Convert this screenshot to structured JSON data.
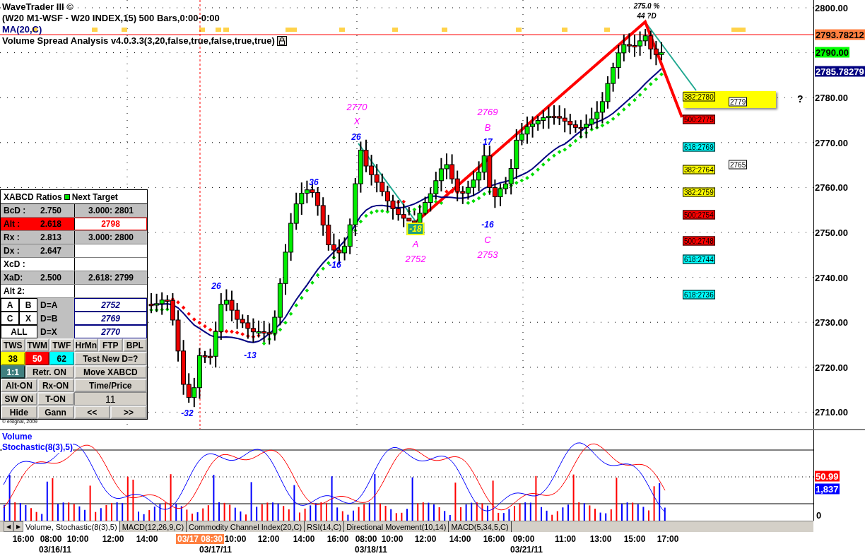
{
  "header": {
    "title": "WaveTrader III ©",
    "symbol_line": "(W20 M1-WSF - W20 INDEX,15) 500 Bars,0:00-0:00",
    "ma_label": "MA(20,C)",
    "study_label": "Volume Spread Analysis v4.0.3.3(3,20,false,true,false,true,true)"
  },
  "top_annotations": [
    "275.0 %",
    "44 ?D"
  ],
  "chart_labels": [
    {
      "text": "2770",
      "kind": "point"
    },
    {
      "text": "X",
      "kind": "point"
    },
    {
      "text": "26",
      "kind": "count"
    },
    {
      "text": "2769",
      "kind": "point"
    },
    {
      "text": "B",
      "kind": "point"
    },
    {
      "text": "17",
      "kind": "count"
    },
    {
      "text": "36",
      "kind": "count"
    },
    {
      "text": "-18",
      "kind": "highlight"
    },
    {
      "text": "-16",
      "kind": "count"
    },
    {
      "text": "A",
      "kind": "point"
    },
    {
      "text": "C",
      "kind": "point"
    },
    {
      "text": "2752",
      "kind": "point"
    },
    {
      "text": "2753",
      "kind": "point"
    },
    {
      "text": "-16",
      "kind": "count"
    },
    {
      "text": "26",
      "kind": "count"
    },
    {
      "text": "-13",
      "kind": "count"
    },
    {
      "text": "-32",
      "kind": "count"
    }
  ],
  "fib_levels": [
    {
      "text": "382:2780",
      "color": "#ffff00"
    },
    {
      "text": "500:2775",
      "color": "#ff0000"
    },
    {
      "text": "618:2769",
      "color": "#00ffff"
    },
    {
      "text": "382:2764",
      "color": "#ffff00"
    },
    {
      "text": "382:2759",
      "color": "#ffff00"
    },
    {
      "text": "500:2754",
      "color": "#ff0000"
    },
    {
      "text": "500:2748",
      "color": "#ff0000"
    },
    {
      "text": "618:2744",
      "color": "#00ffff"
    },
    {
      "text": "618:2736",
      "color": "#00ffff"
    }
  ],
  "projections": [
    "2779",
    "2765"
  ],
  "question_mark": "?",
  "xabcd_panel": {
    "title": "XABCD Ratios",
    "legend": "Next Target",
    "ratios": [
      {
        "label": "BcD :",
        "value": "2.750",
        "target": "3.000: 2801",
        "kind": "filled"
      },
      {
        "label": "Alt  :",
        "value": "2.618",
        "target": "2798",
        "kind": "alert"
      },
      {
        "label": "Rx  :",
        "value": "2.813",
        "target": "3.000: 2800",
        "kind": "filled"
      },
      {
        "label": "Dx  :",
        "value": "2.647",
        "kind": "filled"
      },
      {
        "label": "XcD :",
        "kind": "blank"
      },
      {
        "label": "XaD:",
        "value": "2.500",
        "target": "2.618: 2799",
        "kind": "filled"
      },
      {
        "label": "Alt 2:",
        "kind": "blank"
      }
    ],
    "points": [
      {
        "keys": [
          "A",
          "B"
        ],
        "label": "D=A",
        "value": "2752"
      },
      {
        "keys": [
          "C",
          "X"
        ],
        "label": "D=B",
        "value": "2769"
      },
      {
        "keys": [
          "ALL"
        ],
        "label": "D=X",
        "value": "2770"
      }
    ],
    "button_rows": [
      [
        {
          "label": "TWS"
        },
        {
          "label": "TWM"
        },
        {
          "label": "TWF"
        },
        {
          "label": "HrMn"
        },
        {
          "label": "FTP"
        },
        {
          "label": "BPL"
        }
      ],
      [
        {
          "label": "38",
          "color": "#ffff00"
        },
        {
          "label": "50",
          "color": "#ff0000"
        },
        {
          "label": "62",
          "color": "#00ffff"
        },
        {
          "label": "Test New D=?"
        }
      ],
      [
        {
          "label": "1:1",
          "color": "#408080"
        },
        {
          "label": "Retr. ON"
        },
        {
          "label": "Move XABCD"
        }
      ],
      [
        {
          "label": "Alt-ON"
        },
        {
          "label": "Rx-ON"
        },
        {
          "label": "Time/Price"
        }
      ],
      [
        {
          "label": "SW ON"
        },
        {
          "label": "T-ON"
        },
        {
          "label": "11",
          "kind": "readout"
        }
      ],
      [
        {
          "label": "Hide"
        },
        {
          "label": "Gann"
        },
        {
          "label": "<<"
        },
        {
          "label": ">>"
        }
      ]
    ]
  },
  "copyright": "© eSignal, 2009",
  "price_axis": {
    "ticks": [
      "2800.00",
      "2780.00",
      "2770.00",
      "2760.00",
      "2750.00",
      "2740.00",
      "2730.00",
      "2720.00",
      "2710.00"
    ],
    "badges": [
      {
        "text": "2793.78212",
        "color": "#ff7f3f"
      },
      {
        "text": "2790.00",
        "color": "#00ff00"
      },
      {
        "text": "2785.78279",
        "color": "#000080"
      }
    ]
  },
  "lower_panel": {
    "labels": [
      "Volume",
      "Stochastic(8(3),5)"
    ],
    "badges": [
      {
        "text": "50.99",
        "color": "#ff0000"
      },
      {
        "text": "1,837",
        "color": "#0000ff"
      }
    ],
    "zero": "0"
  },
  "nav": [
    "◀",
    "▶"
  ],
  "tabs": [
    {
      "label": "Volume, Stochastic(8(3),5)",
      "selected": true
    },
    {
      "label": "MACD(12,26,9,C)",
      "selected": false
    },
    {
      "label": "Commodity Channel Index(20,C)",
      "selected": false
    },
    {
      "label": "RSI(14,C)",
      "selected": false
    },
    {
      "label": "Directional Movement(10,14)",
      "selected": false
    },
    {
      "label": "MACD(5,34,5,C)",
      "selected": false
    }
  ],
  "time_axis": {
    "times": [
      "16:00",
      "08:00",
      "10:00",
      "12:00",
      "14:00",
      "10:00",
      "12:00",
      "14:00",
      "16:00",
      "08:00",
      "10:00",
      "12:00",
      "14:00",
      "16:00",
      "09:00",
      "11:00",
      "13:00",
      "15:00",
      "17:00"
    ],
    "cursor": "03/17 08:30",
    "dates": [
      "03/16/11",
      "03/17/11",
      "03/18/11",
      "03/21/11"
    ]
  }
}
